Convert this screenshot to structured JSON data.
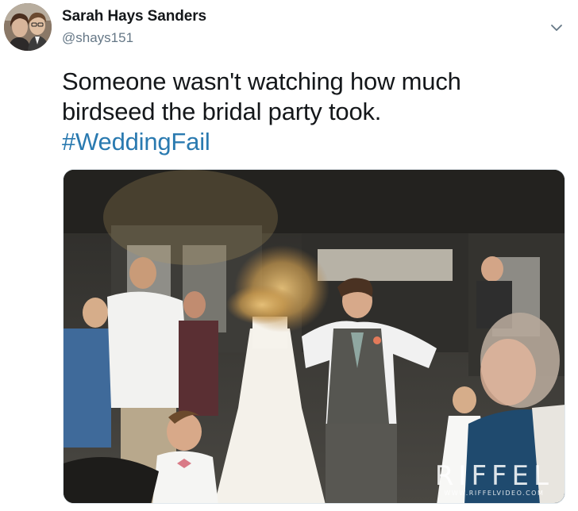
{
  "tweet": {
    "author": {
      "display_name": "Sarah Hays Sanders",
      "handle": "@shays151",
      "avatar_icon": "profile-photo"
    },
    "menu_icon": "chevron-down-icon",
    "text_lines": [
      "Someone wasn't watching how much",
      "birdseed the bridal party took."
    ],
    "hashtag": "#WeddingFail",
    "hashtag_color": "#2a7ab0",
    "media": {
      "description_icon": "wedding-photo",
      "watermark_brand": "RIFFEL",
      "watermark_site": "WWW.RIFFELVIDEO.COM"
    }
  }
}
